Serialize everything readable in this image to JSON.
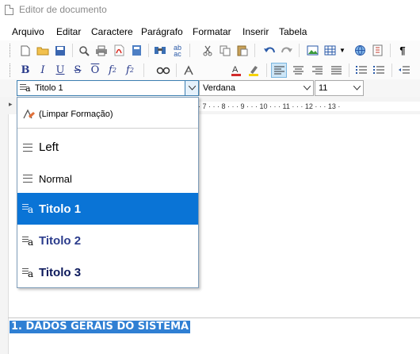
{
  "window": {
    "title": "Editor de documento"
  },
  "menu": [
    "Arquivo",
    "Editar",
    "Caractere",
    "Parágrafo",
    "Formatar",
    "Inserir",
    "Tabela"
  ],
  "toolbar_format": {
    "bold": "B",
    "italic": "I",
    "underline": "U",
    "strike": "S",
    "overline": "O",
    "subscript": "f",
    "superscript": "f"
  },
  "format_bar": {
    "style": "Titolo 1",
    "font": "Verdana",
    "size": "11"
  },
  "ruler": "· 7 · · · 8 · · · 9 · · · 10 · · · 11 · · · 12 · · · 13 ·",
  "style_dropdown": {
    "items": [
      {
        "label": "(Limpar Formação)",
        "icon": "clear-format-icon"
      },
      {
        "label": "Left",
        "icon": "paragraph-lines-icon"
      },
      {
        "label": "Normal",
        "icon": "paragraph-lines-icon"
      },
      {
        "label": "Titolo 1",
        "icon": "style-char-icon",
        "selected": true
      },
      {
        "label": "Titolo 2",
        "icon": "style-char-icon"
      },
      {
        "label": "Titolo 3",
        "icon": "style-char-icon"
      }
    ]
  },
  "document": {
    "heading": "1. DADOS GERAIS DO SISTEMA"
  },
  "colors": {
    "selection": "#0a74d6",
    "heading_highlight": "#2f7fd3",
    "title_style": "#2b3c8c"
  }
}
